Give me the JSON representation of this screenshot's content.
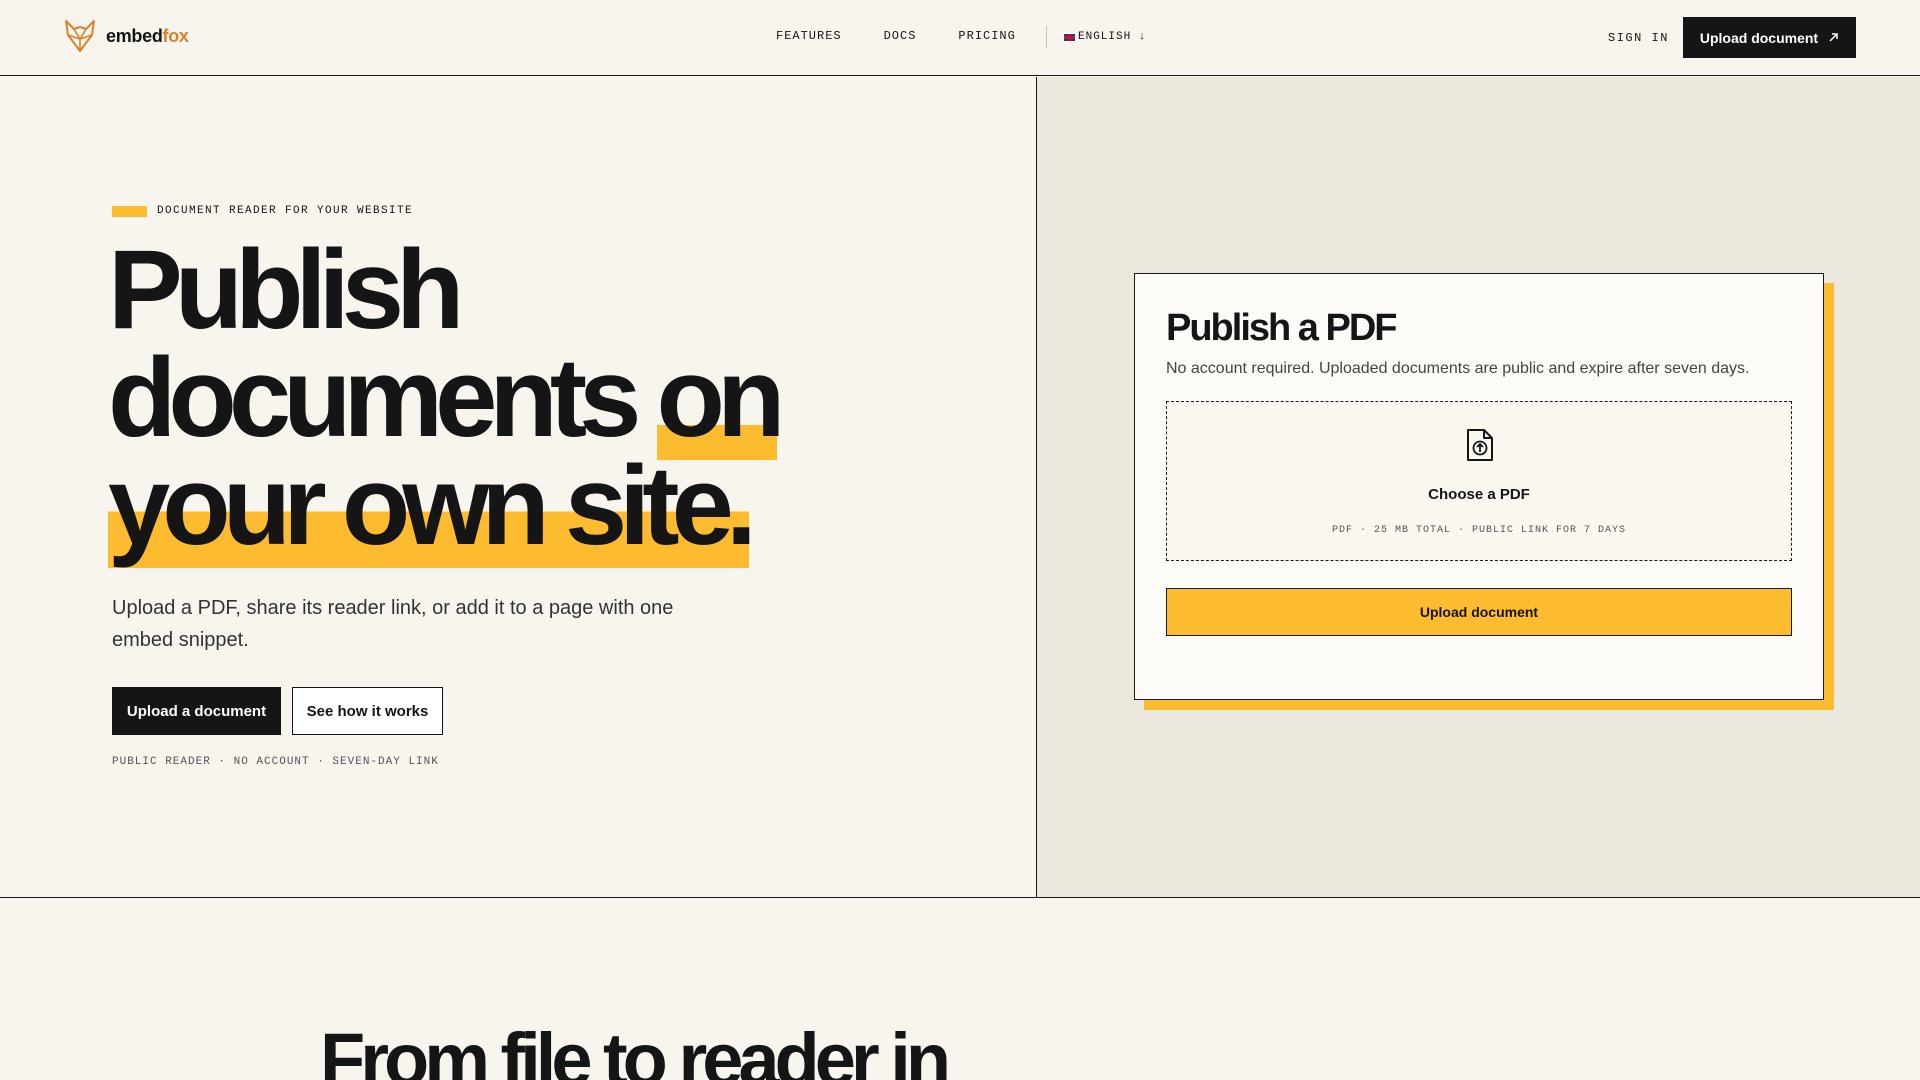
{
  "header": {
    "logo": {
      "part1": "embed",
      "part2": "fox",
      "icon": "fox-icon"
    },
    "nav": [
      "FEATURES",
      "DOCS",
      "PRICING"
    ],
    "language": "ENGLISH ↓",
    "sign_in": "SIGN IN",
    "cta": "Upload document"
  },
  "hero": {
    "eyebrow": "DOCUMENT READER FOR YOUR WEBSITE",
    "headline": {
      "line1": "Publish",
      "line2a": "documents ",
      "line2b": "on",
      "line3": "your own site."
    },
    "subtext": "Upload a PDF, share its reader link, or add it to a page with one embed snippet.",
    "primary_button": "Upload a document",
    "secondary_button": "See how it works",
    "trust": "PUBLIC READER · NO ACCOUNT · SEVEN-DAY LINK"
  },
  "card": {
    "title": "Publish a PDF",
    "description": "No account required. Uploaded documents are public and expire after seven days.",
    "dropzone_title": "Choose a PDF",
    "dropzone_meta": "PDF · 25 MB TOTAL · PUBLIC LINK FOR 7 DAYS",
    "upload_button": "Upload document"
  },
  "next_section": {
    "heading": "From file to reader in"
  },
  "colors": {
    "accent": "#fdbb30",
    "dark": "#151515",
    "background": "#f8f5ef",
    "panel": "#ede8dd",
    "logo_accent": "#d9822b"
  }
}
